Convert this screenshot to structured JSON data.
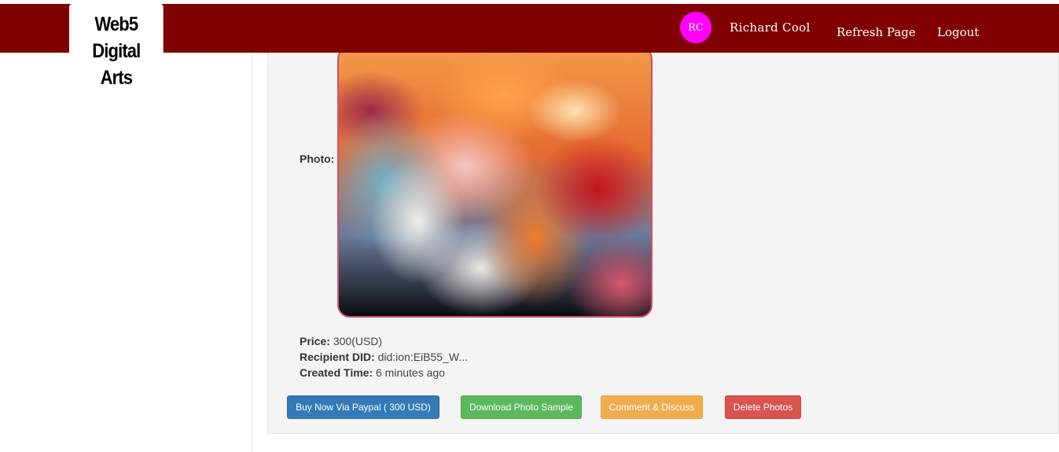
{
  "brand": {
    "line1": "Web5 Digital",
    "line2": "Arts"
  },
  "nav": {
    "avatar_initials": "RC",
    "user_name": "Richard Cool",
    "refresh_label": "Refresh Page",
    "logout_label": "Logout"
  },
  "colors": {
    "topbar": "#800000",
    "avatar": "#ff00ff",
    "photo_border": "#d44e6a",
    "buy_button": "#337ab7",
    "download_button": "#5cb85c",
    "comment_button": "#f0ad4e",
    "delete_button": "#d9534f"
  },
  "photo": {
    "label": "Photo:"
  },
  "details": {
    "price_label": "Price:",
    "price_value": "300(USD)",
    "recipient_label": "Recipient DID:",
    "recipient_value": "did:ion:EiB55_W...",
    "created_label": "Created Time:",
    "created_value": "6 minutes ago"
  },
  "actions": {
    "buy_label": "Buy Now Via Paypal ( 300 USD)",
    "download_label": "Download Photo Sample",
    "comment_label": "Comment & Discuss",
    "delete_label": "Delete Photos"
  }
}
